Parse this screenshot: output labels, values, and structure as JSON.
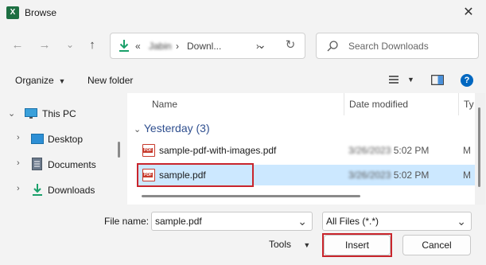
{
  "window": {
    "title": "Browse",
    "app_icon_letter": "X"
  },
  "nav": {
    "back_icon": "←",
    "forward_icon": "→",
    "recent_icon": "⌄",
    "up_icon": "↑",
    "path_overflow": "«",
    "path_user": "Jabin",
    "path_sep1": "›",
    "path_sep2": "›",
    "path_current": "Downl...",
    "path_dropdown": "⌄",
    "refresh_icon": "↻"
  },
  "search": {
    "placeholder": "Search Downloads"
  },
  "commandbar": {
    "organize": "Organize",
    "new_folder": "New folder"
  },
  "tree": [
    {
      "label": "This PC",
      "icon": "monitor-icon",
      "expanded": true
    },
    {
      "label": "Desktop",
      "icon": "desktop-icon"
    },
    {
      "label": "Documents",
      "icon": "documents-icon"
    },
    {
      "label": "Downloads",
      "icon": "downloads-icon"
    }
  ],
  "columns": {
    "name": "Name",
    "date": "Date modified",
    "type": "Ty"
  },
  "group": {
    "label": "Yesterday (3)"
  },
  "files": [
    {
      "name": "sample-pdf-with-images.pdf",
      "date": "3/26/2023",
      "time": "5:02 PM",
      "type": "M"
    },
    {
      "name": "sample.pdf",
      "date": "3/26/2023",
      "time": "5:02 PM",
      "type": "M",
      "selected": true
    }
  ],
  "footer": {
    "filename_label": "File name:",
    "filename_value": "sample.pdf",
    "filter_value": "All Files (*.*)",
    "tools": "Tools",
    "insert": "Insert",
    "cancel": "Cancel"
  },
  "colors": {
    "selection": "#cce8ff",
    "highlight_box": "#c9252c",
    "excel_green": "#1d6f42",
    "accent": "#0067c0"
  }
}
